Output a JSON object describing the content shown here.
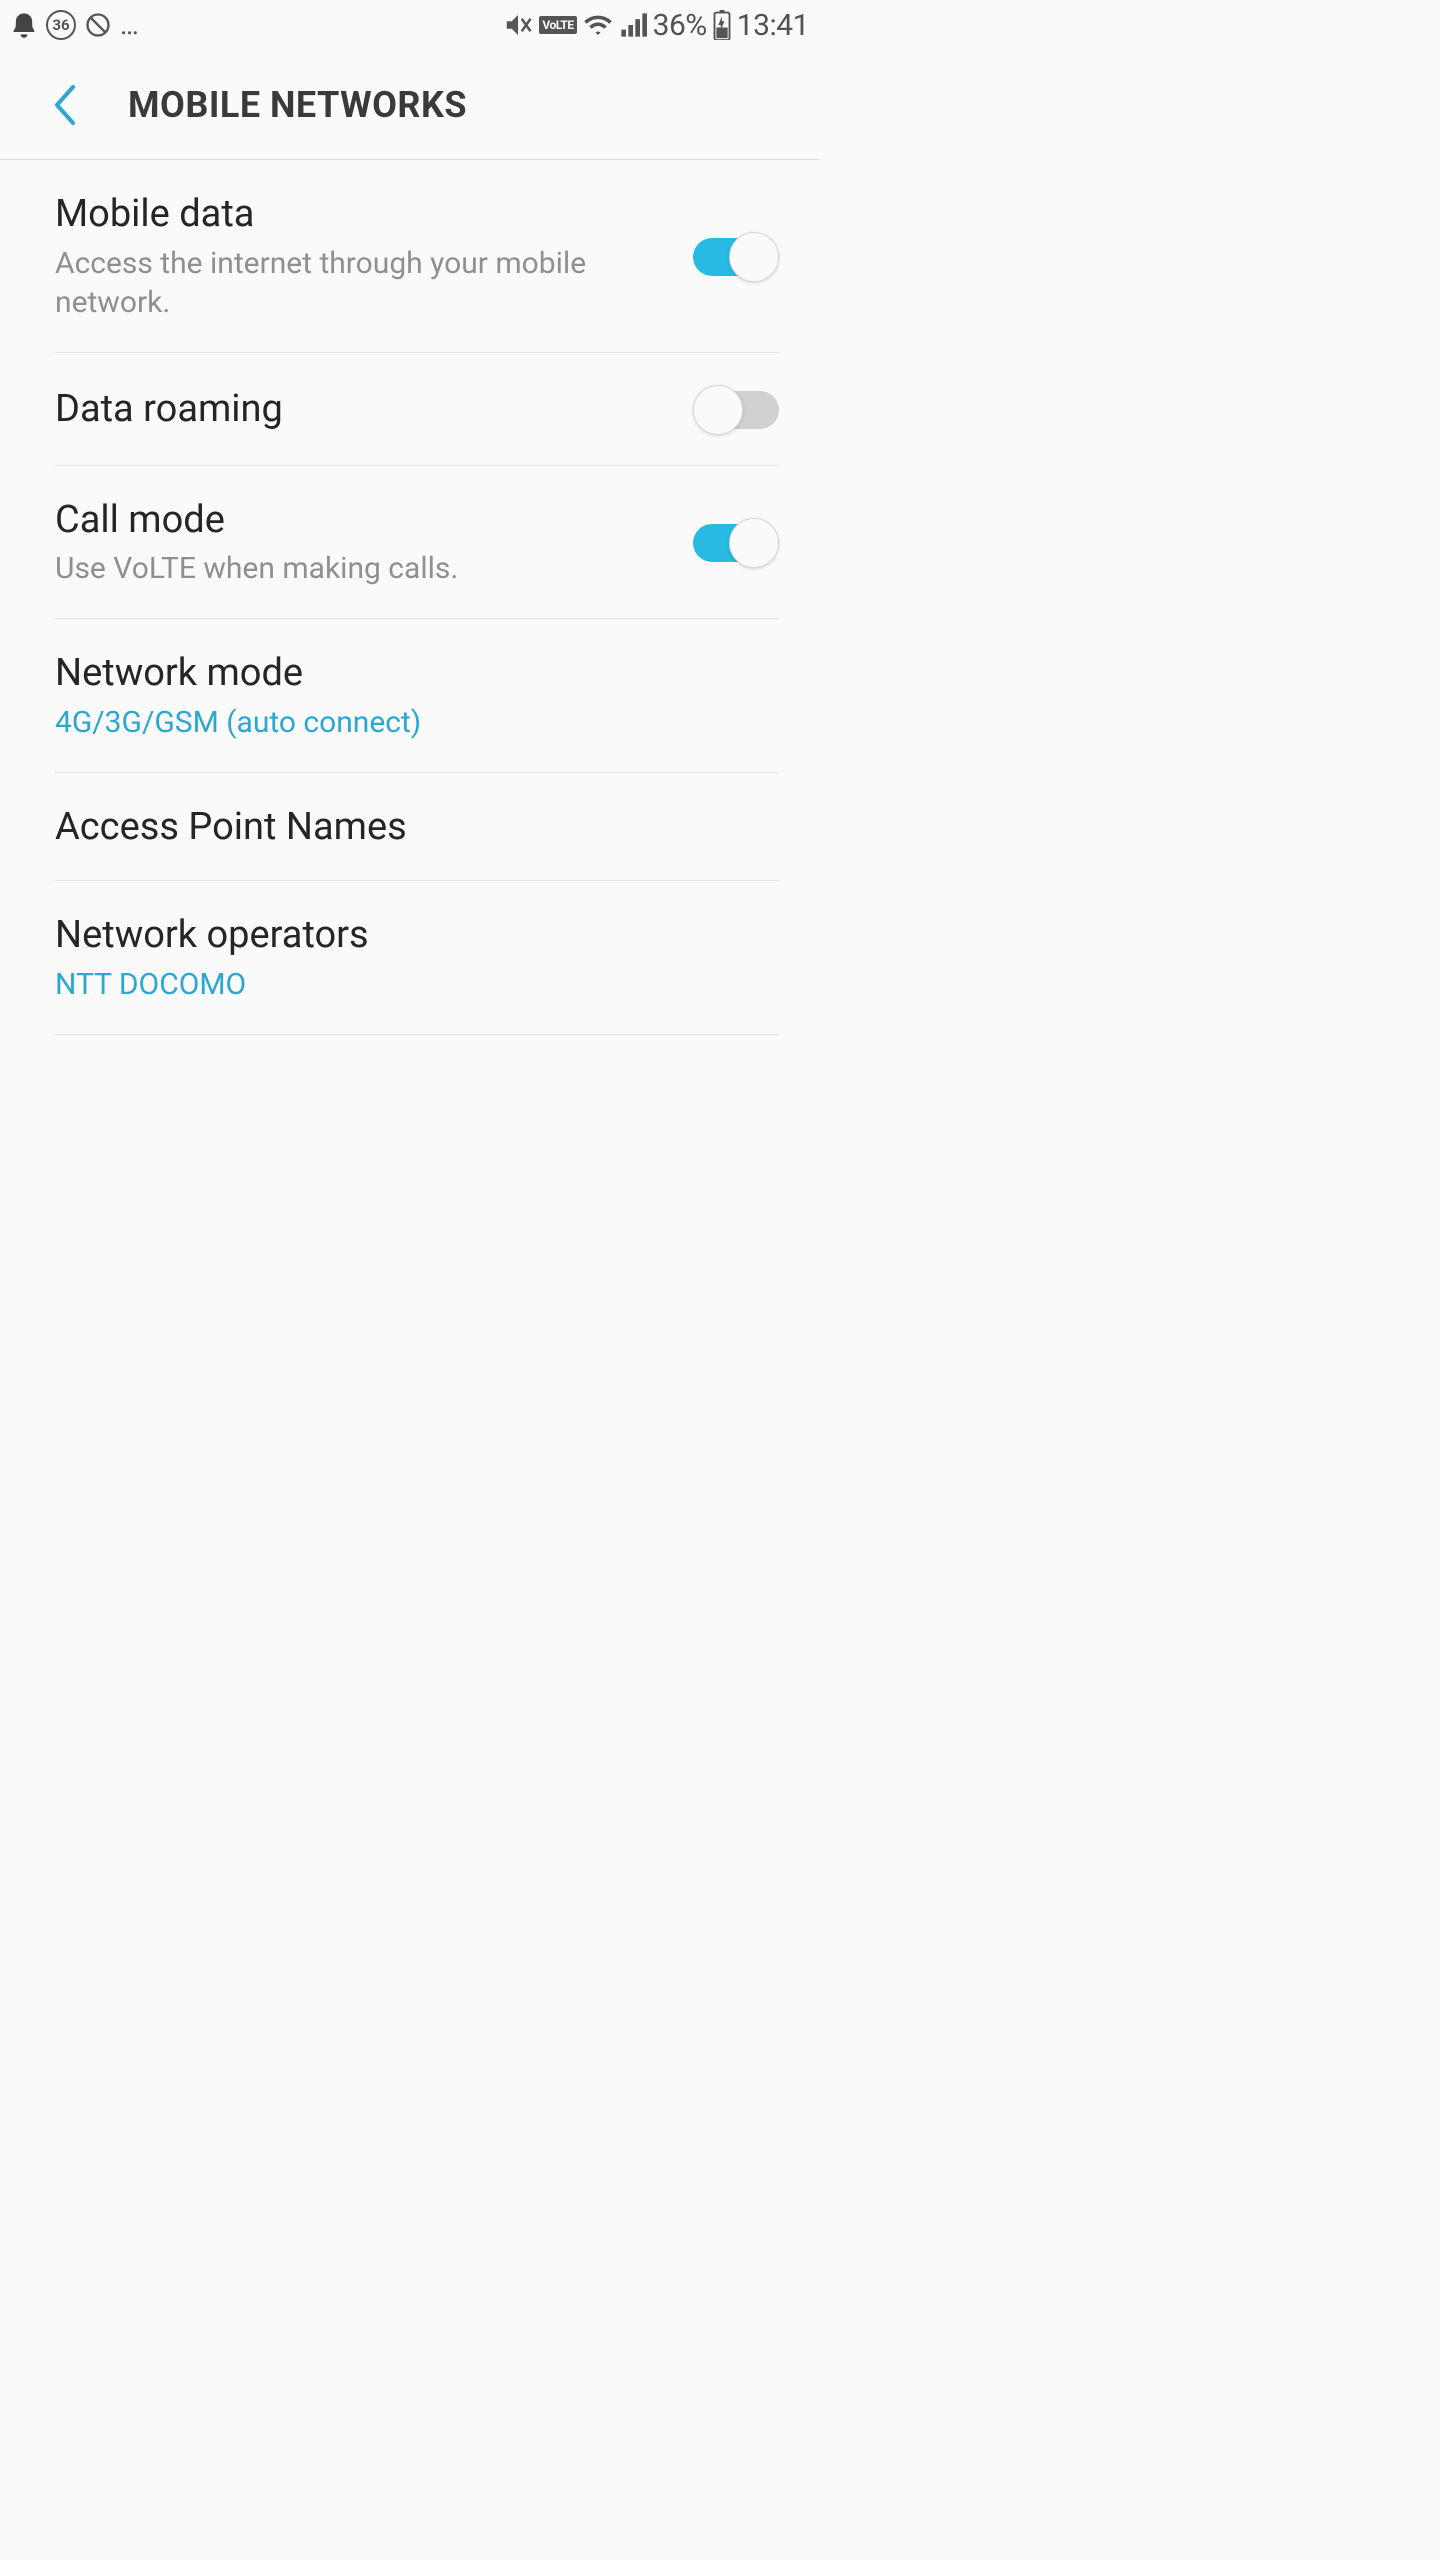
{
  "status_bar": {
    "badge_number": "36",
    "battery_percent": "36%",
    "time": "13:41",
    "volte_label": "VoLTE"
  },
  "header": {
    "title": "MOBILE NETWORKS"
  },
  "settings": {
    "mobile_data": {
      "title": "Mobile data",
      "subtitle": "Access the internet through your mobile network.",
      "on": true
    },
    "data_roaming": {
      "title": "Data roaming",
      "on": false
    },
    "call_mode": {
      "title": "Call mode",
      "subtitle": "Use VoLTE when making calls.",
      "on": true
    },
    "network_mode": {
      "title": "Network mode",
      "value": "4G/3G/GSM (auto connect)"
    },
    "apn": {
      "title": "Access Point Names"
    },
    "operators": {
      "title": "Network operators",
      "value": "NTT DOCOMO"
    }
  },
  "colors": {
    "accent": "#27bbe4",
    "value_text": "#2ba7d0"
  }
}
